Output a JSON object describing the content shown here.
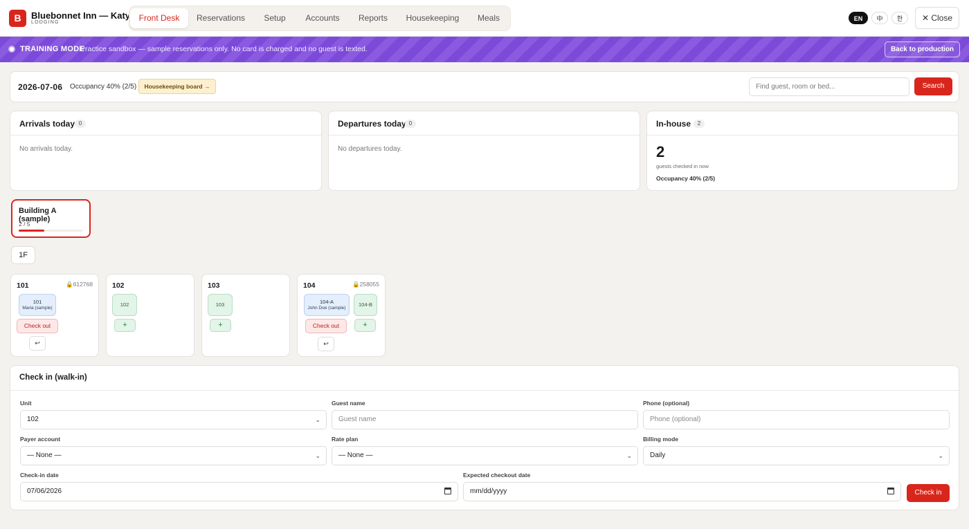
{
  "brand": {
    "logo_letter": "B",
    "title": "Bluebonnet Inn — Katy",
    "subtitle": "LODGING"
  },
  "nav": {
    "tabs": [
      "Front Desk",
      "Reservations",
      "Setup",
      "Accounts",
      "Reports",
      "Housekeeping",
      "Meals"
    ],
    "active": "Front Desk"
  },
  "languages": [
    "EN",
    "中",
    "한"
  ],
  "close_label": "✕ Close",
  "banner": {
    "title": "TRAINING MODE",
    "text": "Practice sandbox — sample reservations only. No card is charged and no guest is texted.",
    "button": "Back to production"
  },
  "datebar": {
    "date": "2026-07-06",
    "occupancy": "Occupancy 40% (2/5)",
    "housekeeping_button": "Housekeeping board →",
    "search_placeholder": "Find guest, room or bed...",
    "search_button": "Search"
  },
  "summary": {
    "arrivals": {
      "title": "Arrivals today",
      "count": "0",
      "empty": "No arrivals today."
    },
    "departures": {
      "title": "Departures today",
      "count": "0",
      "empty": "No departures today."
    },
    "inhouse": {
      "title": "In-house",
      "count": "2",
      "big": "2",
      "sub": "guests checked in now",
      "occupancy": "Occupancy 40% (2/5)"
    }
  },
  "building": {
    "name": "Building A (sample)",
    "count": "2 / 5",
    "occupancy_fraction": 0.4
  },
  "floor": "1F",
  "rooms": [
    {
      "number": "101",
      "lock": "🔒612768",
      "beds": [
        {
          "label": "101",
          "guest": "Maria (sample)",
          "occupied": true
        }
      ],
      "checkout": "Check out",
      "undo": "↩"
    },
    {
      "number": "102",
      "lock": "",
      "beds": [
        {
          "label": "102",
          "occupied": false
        }
      ],
      "plus": "+"
    },
    {
      "number": "103",
      "lock": "",
      "beds": [
        {
          "label": "103",
          "occupied": false
        }
      ],
      "plus": "+"
    },
    {
      "number": "104",
      "lock": "🔒258055",
      "beds": [
        {
          "label": "104-A",
          "guest": "John Doe (sample)",
          "occupied": true
        },
        {
          "label": "104-B",
          "occupied": false
        }
      ],
      "checkout": "Check out",
      "undo": "↩",
      "plus": "+"
    }
  ],
  "checkin_form": {
    "title": "Check in (walk-in)",
    "unit": {
      "label": "Unit",
      "value": "102"
    },
    "guest_name": {
      "label": "Guest name",
      "placeholder": "Guest name"
    },
    "phone": {
      "label": "Phone (optional)",
      "placeholder": "Phone (optional)"
    },
    "payer": {
      "label": "Payer account",
      "value": "— None —"
    },
    "rate_plan": {
      "label": "Rate plan",
      "value": "— None —"
    },
    "billing_mode": {
      "label": "Billing mode",
      "value": "Daily"
    },
    "checkin_date": {
      "label": "Check-in date",
      "value": "07/06/2026"
    },
    "checkout_date": {
      "label": "Expected checkout date",
      "placeholder": "mm/dd/yyyy"
    },
    "submit": "Check in"
  },
  "icons": {
    "chevron": "chevron-down-icon",
    "calendar": "calendar-icon",
    "lock": "lock-icon"
  },
  "colors": {
    "accent": "#d9261c",
    "training": "#7c4ad8",
    "occupied_bed": "#e4eefc",
    "free_bed": "#e3f4e8"
  }
}
